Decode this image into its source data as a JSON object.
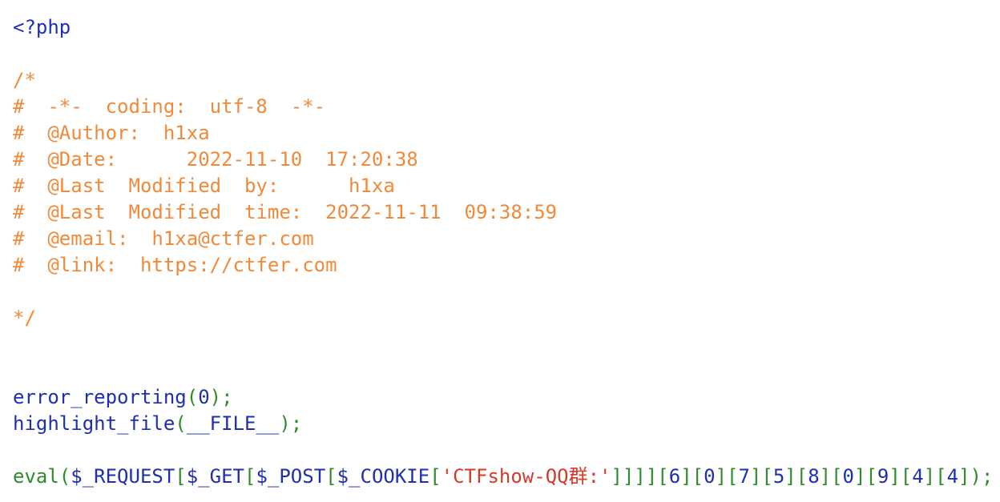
{
  "code": {
    "language": "php",
    "lines": [
      [
        {
          "text": "<?php",
          "color": "default"
        }
      ],
      [],
      [
        {
          "text": "/*",
          "color": "comment"
        }
      ],
      [
        {
          "text": "#  -*-  coding:  utf-8  -*-",
          "color": "comment"
        }
      ],
      [
        {
          "text": "#  @Author:  h1xa",
          "color": "comment"
        }
      ],
      [
        {
          "text": "#  @Date:      2022-11-10  17:20:38",
          "color": "comment"
        }
      ],
      [
        {
          "text": "#  @Last  Modified  by:      h1xa",
          "color": "comment"
        }
      ],
      [
        {
          "text": "#  @Last  Modified  time:  2022-11-11  09:38:59",
          "color": "comment"
        }
      ],
      [
        {
          "text": "#  @email:  h1xa@ctfer.com",
          "color": "comment"
        }
      ],
      [
        {
          "text": "#  @link:  https://ctfer.com",
          "color": "comment"
        }
      ],
      [],
      [
        {
          "text": "*/",
          "color": "comment"
        }
      ],
      [],
      [],
      [
        {
          "text": "error_reporting",
          "color": "plain"
        },
        {
          "text": "(",
          "color": "keyword"
        },
        {
          "text": "0",
          "color": "plain"
        },
        {
          "text": ");",
          "color": "keyword"
        }
      ],
      [
        {
          "text": "highlight_file",
          "color": "plain"
        },
        {
          "text": "(",
          "color": "keyword"
        },
        {
          "text": "__FILE__",
          "color": "plain"
        },
        {
          "text": ");",
          "color": "keyword"
        }
      ],
      [],
      [
        {
          "text": "eval",
          "color": "keyword"
        },
        {
          "text": "(",
          "color": "keyword"
        },
        {
          "text": "$_REQUEST",
          "color": "plain"
        },
        {
          "text": "[",
          "color": "keyword"
        },
        {
          "text": "$_GET",
          "color": "plain"
        },
        {
          "text": "[",
          "color": "keyword"
        },
        {
          "text": "$_POST",
          "color": "plain"
        },
        {
          "text": "[",
          "color": "keyword"
        },
        {
          "text": "$_COOKIE",
          "color": "plain"
        },
        {
          "text": "[",
          "color": "keyword"
        },
        {
          "text": "'CTFshow-QQ群:'",
          "color": "string"
        },
        {
          "text": "]]]][",
          "color": "keyword"
        },
        {
          "text": "6",
          "color": "plain"
        },
        {
          "text": "][",
          "color": "keyword"
        },
        {
          "text": "0",
          "color": "plain"
        },
        {
          "text": "][",
          "color": "keyword"
        },
        {
          "text": "7",
          "color": "plain"
        },
        {
          "text": "][",
          "color": "keyword"
        },
        {
          "text": "5",
          "color": "plain"
        },
        {
          "text": "][",
          "color": "keyword"
        },
        {
          "text": "8",
          "color": "plain"
        },
        {
          "text": "][",
          "color": "keyword"
        },
        {
          "text": "0",
          "color": "plain"
        },
        {
          "text": "][",
          "color": "keyword"
        },
        {
          "text": "9",
          "color": "plain"
        },
        {
          "text": "][",
          "color": "keyword"
        },
        {
          "text": "4",
          "color": "plain"
        },
        {
          "text": "][",
          "color": "keyword"
        },
        {
          "text": "4",
          "color": "plain"
        },
        {
          "text": "]);",
          "color": "keyword"
        }
      ]
    ]
  },
  "colors": {
    "default": "#1f2fbf",
    "comment": "#f08a3a",
    "keyword": "#2e8b2e",
    "string": "#d23a2a",
    "plain": "#1e2fb0",
    "background": "#ffffff"
  }
}
